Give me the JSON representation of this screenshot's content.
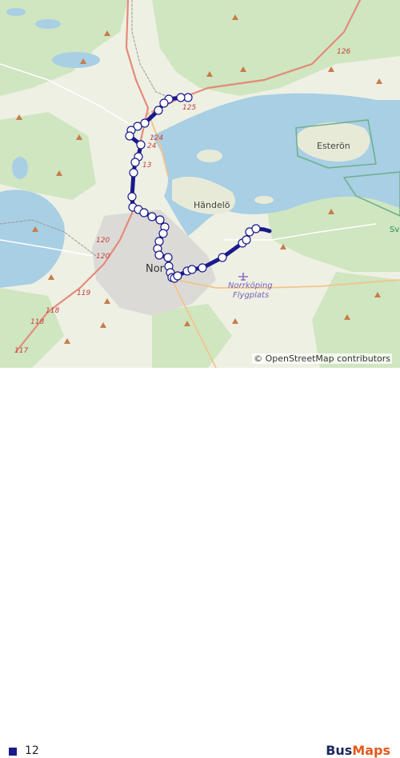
{
  "map": {
    "places": {
      "esteron": "Esterön",
      "handelo": "Händelö",
      "norrkoping_short": "Nor",
      "airport_line1": "Norrköping",
      "airport_line2": "Flygplats",
      "sv": "Sv"
    },
    "shields": [
      "126",
      "125",
      "124",
      "24",
      "13",
      "120",
      "120",
      "119",
      "118",
      "118",
      "117"
    ],
    "attribution": "© OpenStreetMap contributors"
  },
  "legend": {
    "route_label": "12",
    "route_color": "#1a1a8c"
  },
  "brand": {
    "part1": "Bus",
    "part2": "Maps"
  },
  "route": {
    "stops_count": 38
  }
}
